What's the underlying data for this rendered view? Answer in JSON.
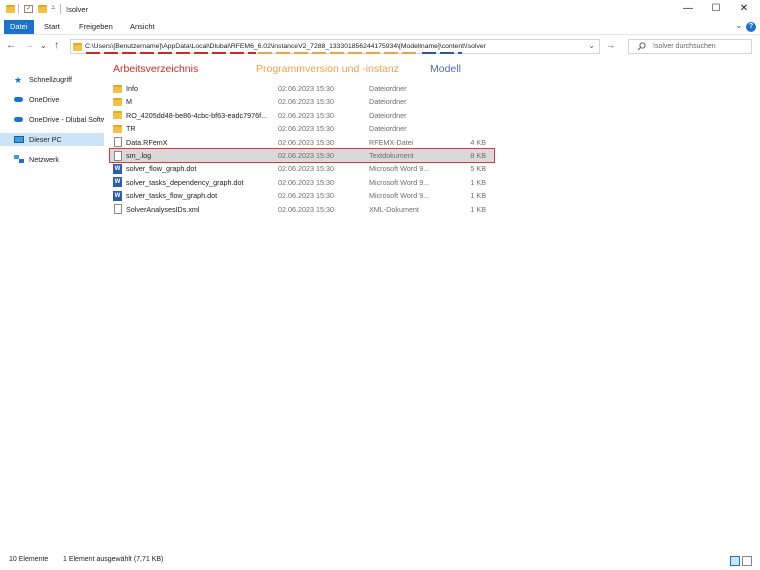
{
  "window": {
    "title": "!solver",
    "minimize_glyph": "—",
    "maximize_glyph": "☐",
    "close_glyph": "✕"
  },
  "ribbon": {
    "tabs": [
      {
        "label": "Datei"
      },
      {
        "label": "Start"
      },
      {
        "label": "Freigeben"
      },
      {
        "label": "Ansicht"
      }
    ],
    "expand_glyph": "⌄",
    "help_glyph": "?"
  },
  "address": {
    "path": "C:\\Users\\[Benutzername]\\AppData\\Local\\Dlubal\\RFEM6_6.02\\instanceV2_7288_133301856244175934\\[Modellname]\\content\\!solver",
    "back_glyph": "←",
    "forward_glyph": "→",
    "recent_glyph": "⌄",
    "up_glyph": "↑",
    "dropdown_glyph": "⌄",
    "go_glyph": "→",
    "search_placeholder": "!solver durchsuchen"
  },
  "annotations": {
    "arbeitsverzeichnis": {
      "label": "Arbeitsverzeichnis",
      "color": "#cc2a2a"
    },
    "programmversion": {
      "label": "Programmversion und -instanz",
      "color": "#f0a04a"
    },
    "modell": {
      "label": "Modell",
      "color": "#4a6fb0"
    }
  },
  "sidebar": {
    "items": [
      {
        "label": "Schnellzugriff",
        "icon": "star-icon"
      },
      {
        "label": "OneDrive",
        "icon": "cloud-icon"
      },
      {
        "label": "OneDrive - Dlubal Software",
        "icon": "cloud-icon"
      },
      {
        "label": "Dieser PC",
        "icon": "computer-icon"
      },
      {
        "label": "Netzwerk",
        "icon": "network-icon"
      }
    ]
  },
  "files": [
    {
      "name": "Info",
      "date": "02.06.2023 15:30",
      "type": "Dateiordner",
      "size": "",
      "icon": "folder"
    },
    {
      "name": "M",
      "date": "02.06.2023 15:30",
      "type": "Dateiordner",
      "size": "",
      "icon": "folder"
    },
    {
      "name": "RO_4205dd48-be86-4cbc-bf63-eadc7976f...",
      "date": "02.06.2023 15:30",
      "type": "Dateiordner",
      "size": "",
      "icon": "folder"
    },
    {
      "name": "TR",
      "date": "02.06.2023 15:30",
      "type": "Dateiordner",
      "size": "",
      "icon": "folder"
    },
    {
      "name": "Data.RFemX",
      "date": "02.06.2023 15:30",
      "type": "RFEMX-Datei",
      "size": "4 KB",
      "icon": "doc"
    },
    {
      "name": "sm_.log",
      "date": "02.06.2023 15:30",
      "type": "Textdokument",
      "size": "8 KB",
      "icon": "doc"
    },
    {
      "name": "solver_flow_graph.dot",
      "date": "02.06.2023 15:30",
      "type": "Microsoft Word 9...",
      "size": "5 KB",
      "icon": "word"
    },
    {
      "name": "solver_tasks_dependency_graph.dot",
      "date": "02.06.2023 15:30",
      "type": "Microsoft Word 9...",
      "size": "1 KB",
      "icon": "word"
    },
    {
      "name": "solver_tasks_flow_graph.dot",
      "date": "02.06.2023 15:30",
      "type": "Microsoft Word 9...",
      "size": "1 KB",
      "icon": "word"
    },
    {
      "name": "SolverAnalysesIDs.xml",
      "date": "02.06.2023 15:30",
      "type": "XML-Dokument",
      "size": "1 KB",
      "icon": "xml"
    }
  ],
  "status": {
    "count": "10 Elemente",
    "selection": "1 Element ausgewählt (7,71 KB)"
  }
}
